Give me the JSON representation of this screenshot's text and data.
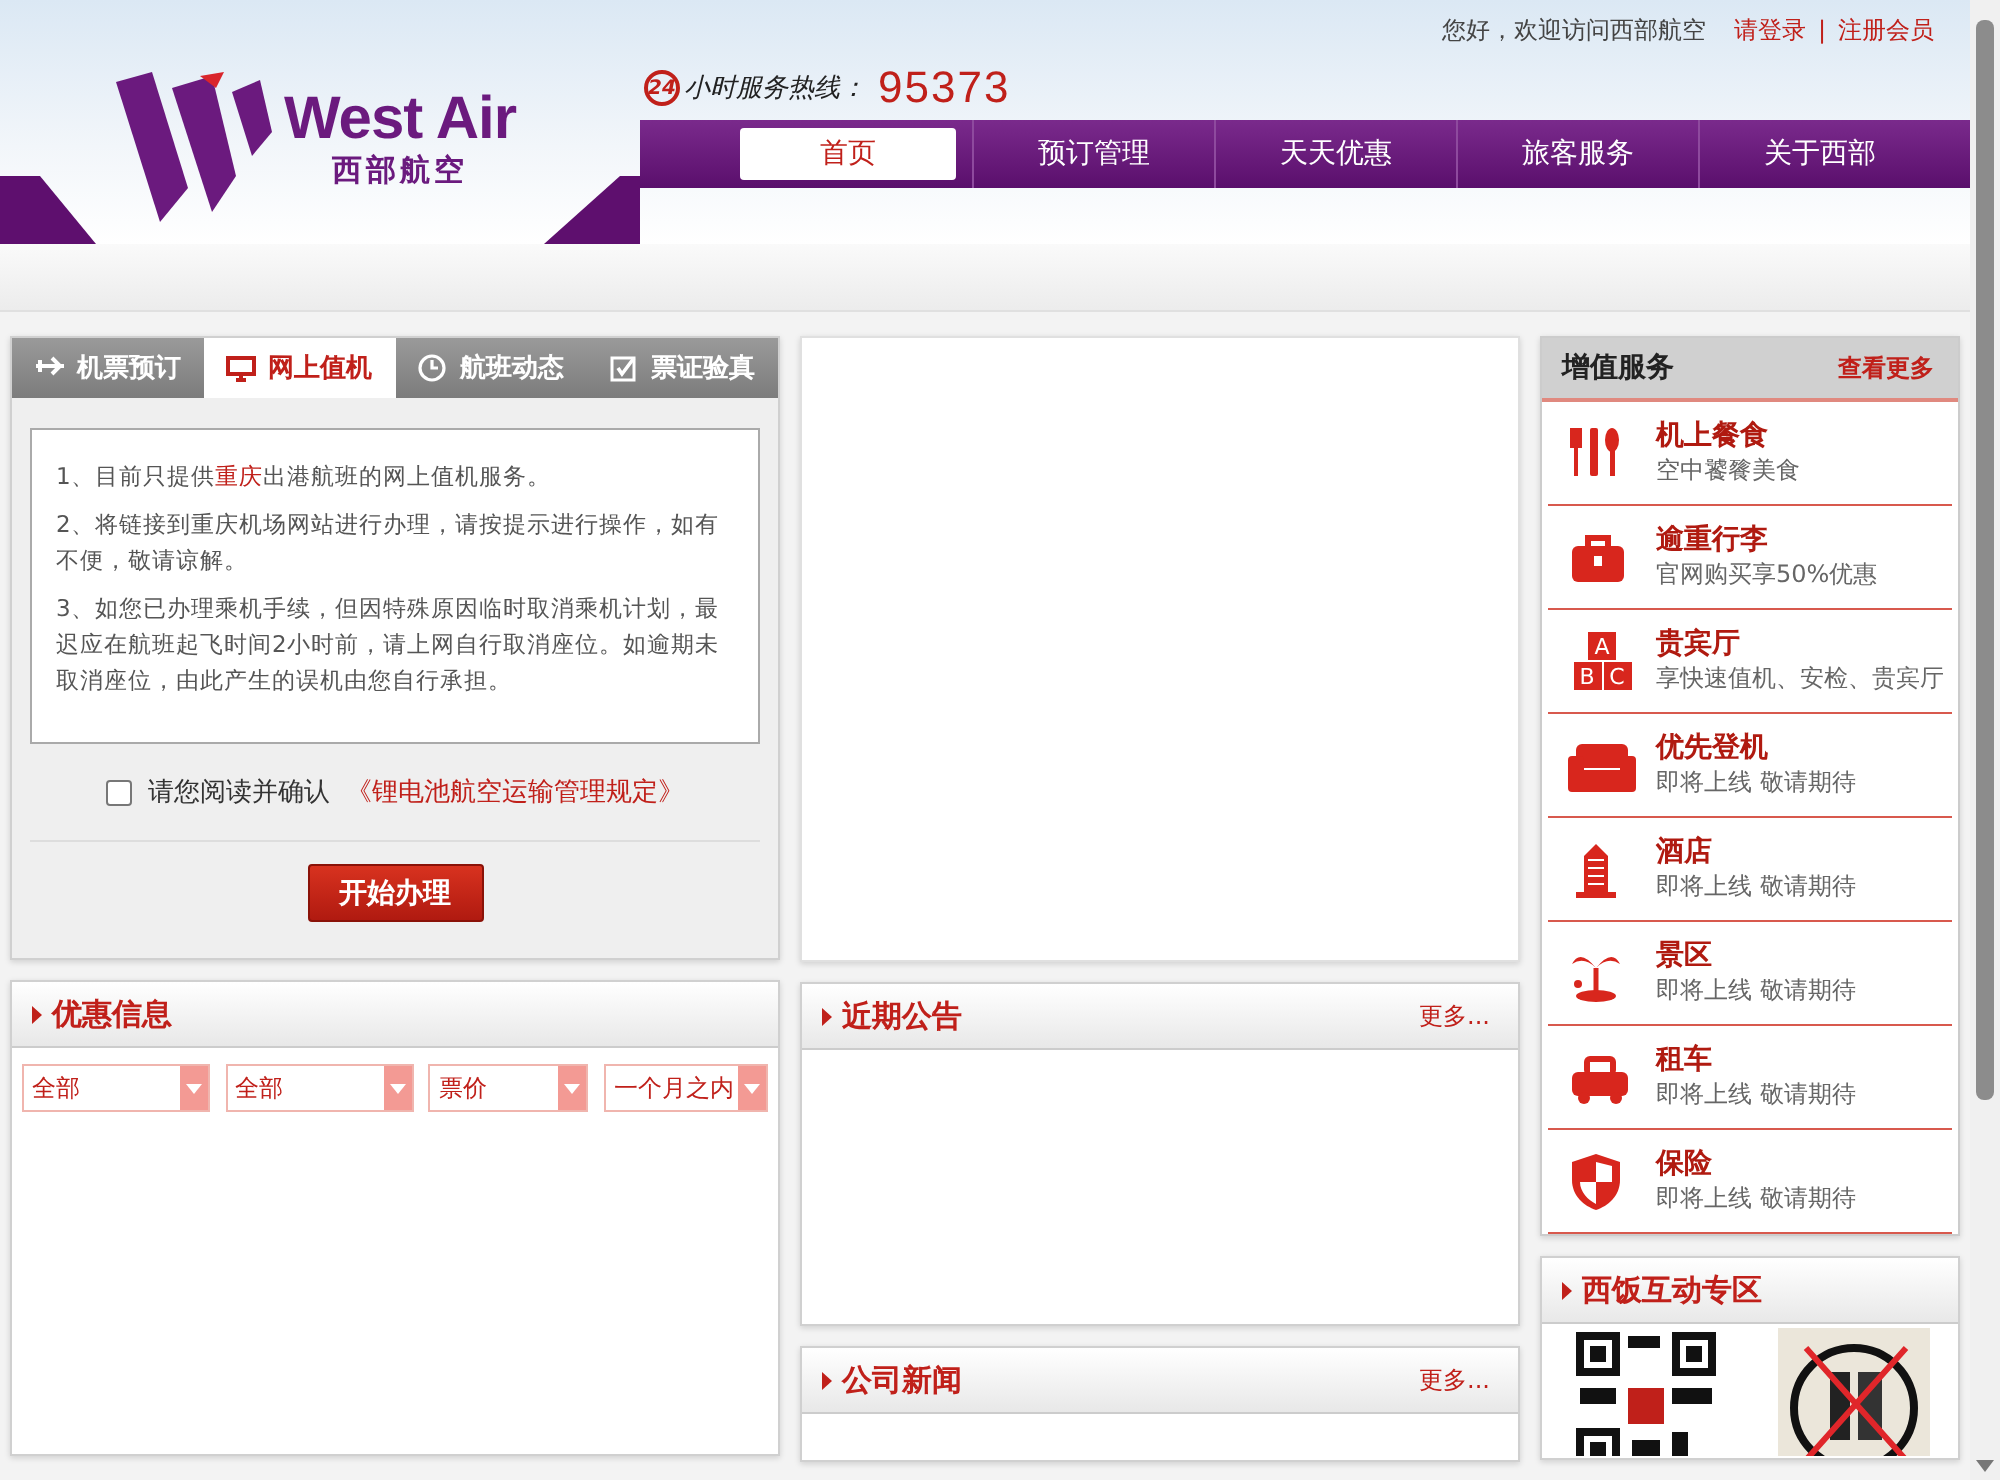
{
  "header": {
    "greeting": "您好，欢迎访问西部航空",
    "login": "请登录",
    "separator": "|",
    "register": "注册会员",
    "logo_en": "West Air",
    "logo_cn": "西部航空",
    "hotline_badge": "24",
    "hotline_label": "小时服务热线：",
    "hotline_number": "95373"
  },
  "nav": [
    {
      "label": "首页",
      "selected": true
    },
    {
      "label": "预订管理",
      "selected": false
    },
    {
      "label": "天天优惠",
      "selected": false
    },
    {
      "label": "旅客服务",
      "selected": false
    },
    {
      "label": "关于西部",
      "selected": false
    }
  ],
  "booking_tabs": [
    {
      "label": "机票预订",
      "kind": "plane",
      "selected": false
    },
    {
      "label": "网上值机",
      "kind": "monitor",
      "selected": true
    },
    {
      "label": "航班动态",
      "kind": "clock",
      "selected": false
    },
    {
      "label": "票证验真",
      "kind": "check",
      "selected": false
    }
  ],
  "checkin": {
    "notes": [
      "1、目前只提供**重庆**出港航班的网上值机服务。",
      "2、将链接到重庆机场网站进行办理，请按提示进行操作，如有不便，敬请谅解。",
      "3、如您已办理乘机手续，但因特殊原因临时取消乘机计划，最迟应在航班起飞时间2小时前，请上网自行取消座位。如逾期未取消座位，由此产生的误机由您自行承担。"
    ],
    "confirm_label": "请您阅读并确认",
    "confirm_link": "《锂电池航空运输管理规定》",
    "checked": false,
    "button": "开始办理"
  },
  "deals": {
    "title": "优惠信息",
    "filters": [
      "全部",
      "全部",
      "票价",
      "一个月之内"
    ]
  },
  "notices": {
    "title": "近期公告",
    "more": "更多..."
  },
  "news": {
    "title": "公司新闻",
    "more": "更多..."
  },
  "services": {
    "title": "增值服务",
    "more": "查看更多",
    "items": [
      {
        "kind": "meal",
        "title": "机上餐食",
        "subtitle": "空中饕餮美食"
      },
      {
        "kind": "luggage",
        "title": "逾重行李",
        "subtitle": "官网购买享50%优惠"
      },
      {
        "kind": "abc",
        "title": "贵宾厅",
        "subtitle": "享快速值机、安检、贵宾厅",
        "icon_letters": [
          "A",
          "B",
          "C"
        ]
      },
      {
        "kind": "sofa",
        "title": "优先登机",
        "subtitle": "即将上线 敬请期待"
      },
      {
        "kind": "hotel",
        "title": "酒店",
        "subtitle": "即将上线 敬请期待"
      },
      {
        "kind": "palm",
        "title": "景区",
        "subtitle": "即将上线 敬请期待"
      },
      {
        "kind": "car",
        "title": "租车",
        "subtitle": "即将上线 敬请期待"
      },
      {
        "kind": "shield",
        "title": "保险",
        "subtitle": "即将上线 敬请期待"
      }
    ]
  },
  "interactive": {
    "title": "西饭互动专区"
  }
}
